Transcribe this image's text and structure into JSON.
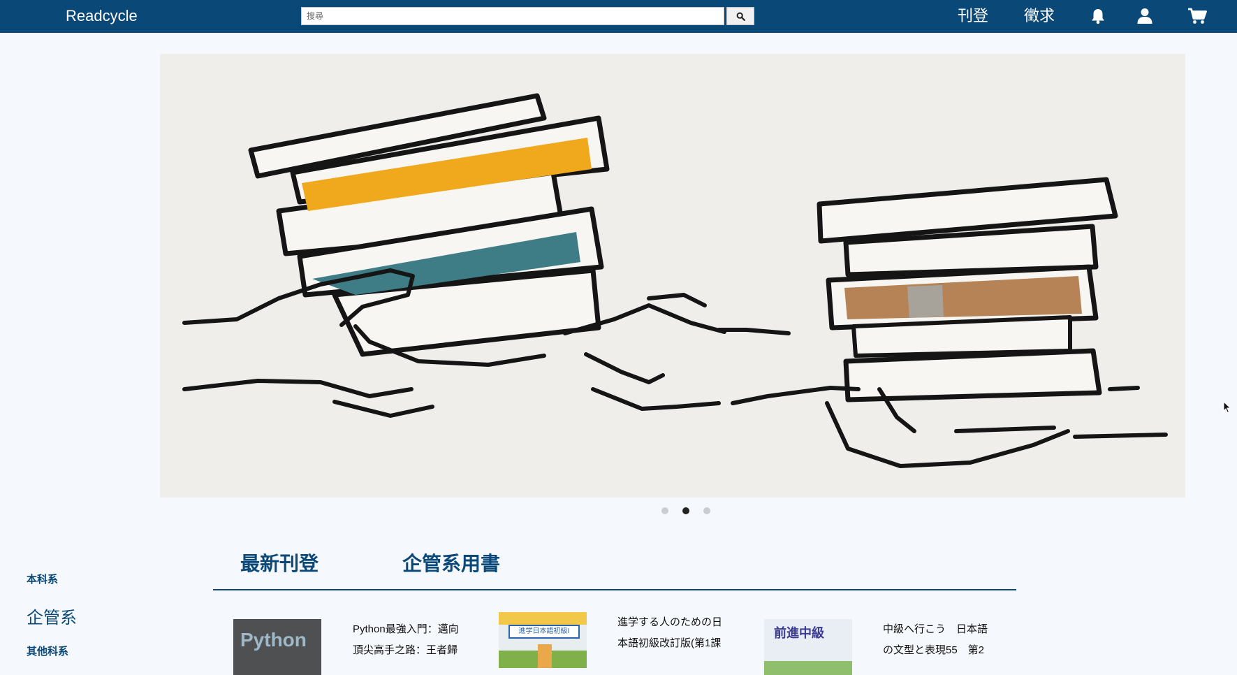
{
  "navbar": {
    "brand": "Readcycle",
    "search_placeholder": "搜尋",
    "links": [
      "刊登",
      "徵求"
    ],
    "icons": [
      "search-icon",
      "bell-icon",
      "user-icon",
      "cart-icon"
    ]
  },
  "carousel": {
    "slide_count": 3,
    "active_index": 1
  },
  "sidebar": {
    "items": [
      "本科系",
      "企管系",
      "其他科系"
    ]
  },
  "tabs": [
    "最新刊登",
    "企管系用書"
  ],
  "books": [
    {
      "title_line1": "Python最強入門：邁向",
      "title_line2": "頂尖高手之路：王者歸",
      "cover_text": "Python"
    },
    {
      "title_line1": "進学する人のための日",
      "title_line2": "本語初級改訂版(第1課",
      "cover_text": "進学日本語初級Ⅰ"
    },
    {
      "title_line1": "中級へ行こう　日本語",
      "title_line2": "の文型と表現55　第2",
      "cover_text": "前進中級"
    }
  ],
  "colors": {
    "navbar": "#0a4878",
    "accent": "#0a4878",
    "page_background": "#f5f8fc",
    "hero_background": "#efeeeb",
    "book_orange": "#f0a81c",
    "book_teal": "#3f7d86",
    "book_brown": "#b58356"
  }
}
